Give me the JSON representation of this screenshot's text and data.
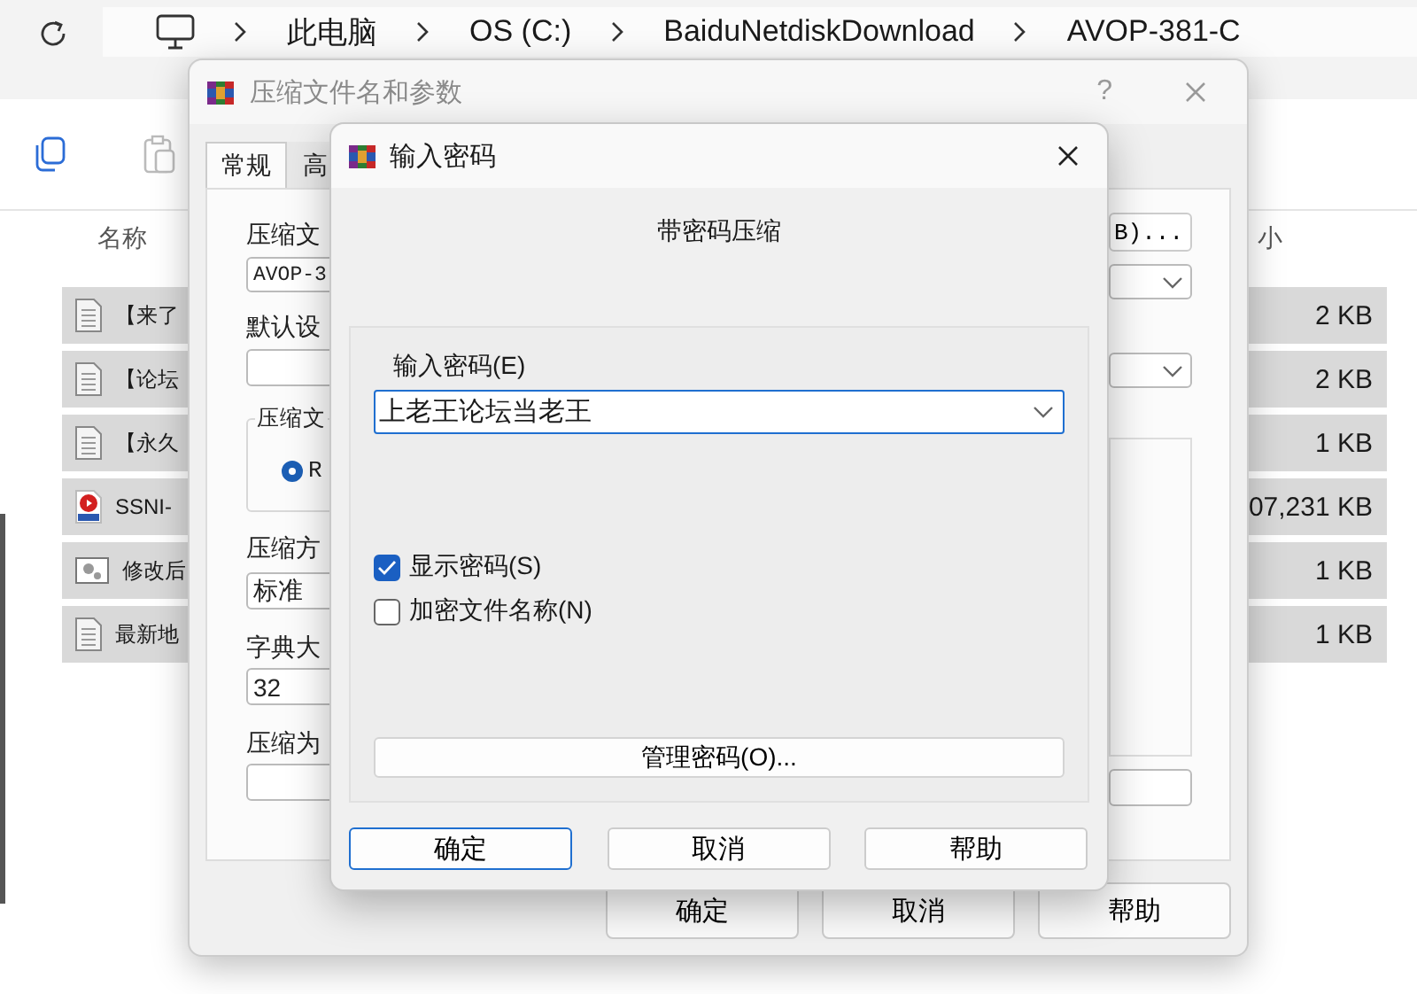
{
  "explorer": {
    "breadcrumb": [
      "此电脑",
      "OS (C:)",
      "BaiduNetdiskDownload",
      "AVOP-381-C"
    ],
    "columns": [
      "名称",
      "小"
    ],
    "files": [
      {
        "kind": "text",
        "name": "【来了",
        "size": "2 KB"
      },
      {
        "kind": "text",
        "name": "【论坛",
        "size": "2 KB"
      },
      {
        "kind": "text",
        "name": "【永久",
        "size": "1 KB"
      },
      {
        "kind": "video",
        "name": "SSNI-",
        "size": "07,231 KB"
      },
      {
        "kind": "image",
        "name": "修改后",
        "size": "1 KB"
      },
      {
        "kind": "text",
        "name": "最新地",
        "size": "1 KB"
      }
    ]
  },
  "archive_dialog": {
    "title": "压缩文件名和参数",
    "help_button": "?",
    "tabs": [
      {
        "label": "常规",
        "selected": true
      },
      {
        "label": "高",
        "selected": false
      }
    ],
    "archive_name_label": "压缩文",
    "archive_name": "AVOP-3",
    "browse_button": "B)...",
    "profile_label": "默认设",
    "format_group": "压缩文",
    "format_option": {
      "label": "R",
      "selected": true
    },
    "method_label": "压缩方",
    "method": "标准",
    "dictionary_label": "字典大",
    "dictionary": "32",
    "split_label": "压缩为",
    "buttons": [
      "确定",
      "取消",
      "帮助"
    ]
  },
  "password_dialog": {
    "title": "输入密码",
    "heading": "带密码压缩",
    "password_label": "输入密码(E)",
    "password": "上老王论坛当老王",
    "options": [
      {
        "label": "显示密码(S)",
        "checked": true
      },
      {
        "label": "加密文件名称(N)",
        "checked": false
      }
    ],
    "manage_button": "管理密码(O)...",
    "buttons": [
      {
        "label": "确定",
        "default": true
      },
      {
        "label": "取消",
        "default": false
      },
      {
        "label": "帮助",
        "default": false
      }
    ]
  }
}
